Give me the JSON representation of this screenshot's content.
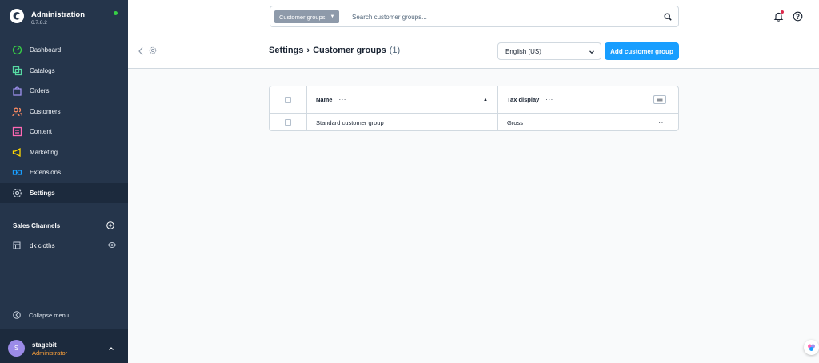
{
  "brand": {
    "title": "Administration",
    "version": "6.7.8.2"
  },
  "nav": [
    {
      "label": "Dashboard",
      "icon": "dashboard-icon",
      "color": "#37d046"
    },
    {
      "label": "Catalogs",
      "icon": "catalogs-icon",
      "color": "#57d9a3"
    },
    {
      "label": "Orders",
      "icon": "orders-icon",
      "color": "#a092f0"
    },
    {
      "label": "Customers",
      "icon": "customers-icon",
      "color": "#f88962"
    },
    {
      "label": "Content",
      "icon": "content-icon",
      "color": "#ff68b4"
    },
    {
      "label": "Marketing",
      "icon": "marketing-icon",
      "color": "#ffd700"
    },
    {
      "label": "Extensions",
      "icon": "extensions-icon",
      "color": "#189eff"
    },
    {
      "label": "Settings",
      "icon": "settings-icon",
      "color": "#9aa8b5",
      "active": true
    }
  ],
  "sales_channels": {
    "header": "Sales Channels",
    "items": [
      {
        "label": "dk cloths"
      }
    ]
  },
  "collapse_label": "Collapse menu",
  "user": {
    "initial": "S",
    "name": "stagebit",
    "role": "Administrator"
  },
  "search": {
    "scope": "Customer groups",
    "placeholder": "Search customer groups..."
  },
  "header": {
    "breadcrumb_parent": "Settings",
    "breadcrumb_current": "Customer groups",
    "count": "(1)",
    "language": "English (US)",
    "add_button": "Add customer group"
  },
  "grid": {
    "columns": {
      "name": "Name",
      "tax": "Tax display"
    },
    "rows": [
      {
        "name": "Standard customer group",
        "tax": "Gross"
      }
    ]
  },
  "colors": {
    "accent": "#189eff",
    "sidebar": "#25354b",
    "role": "#ffa23a"
  }
}
